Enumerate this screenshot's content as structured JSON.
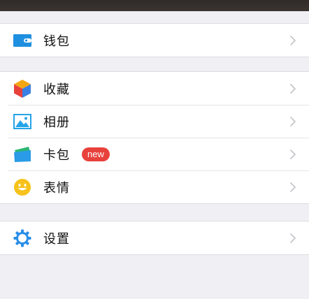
{
  "groups": [
    {
      "items": [
        {
          "label": "钱包",
          "icon": "wallet-icon"
        }
      ]
    },
    {
      "items": [
        {
          "label": "收藏",
          "icon": "favorites-cube-icon"
        },
        {
          "label": "相册",
          "icon": "album-picture-icon"
        },
        {
          "label": "卡包",
          "icon": "card-pack-icon",
          "badge": "new"
        },
        {
          "label": "表情",
          "icon": "smiley-face-icon"
        }
      ]
    },
    {
      "items": [
        {
          "label": "设置",
          "icon": "gear-icon"
        }
      ]
    }
  ],
  "colors": {
    "background": "#efeff4",
    "wallet": "#1f8fe0",
    "badge": "#e8413c",
    "album": "#26a4e8",
    "smiley": "#f7c21b",
    "gear": "#2a8ee8"
  }
}
